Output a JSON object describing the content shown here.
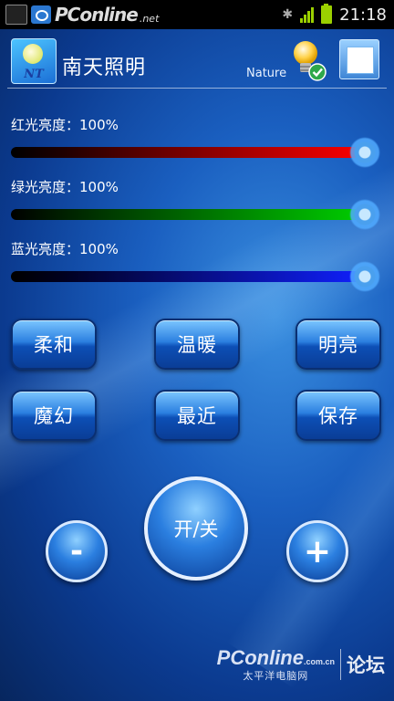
{
  "status_bar": {
    "brand": "PConline",
    "brand_net": ".net",
    "time": "21:18"
  },
  "header": {
    "app_title": "南天照明",
    "logo_text": "NT",
    "mode_label": "Nature"
  },
  "sliders": [
    {
      "label": "红光亮度：100%",
      "color": "#ff0000",
      "level": 1.0
    },
    {
      "label": "绿光亮度：100%",
      "color": "#00d000",
      "level": 1.0
    },
    {
      "label": "蓝光亮度：100%",
      "color": "#1020ff",
      "level": 1.0
    }
  ],
  "presets": {
    "soft": "柔和",
    "warm": "温暖",
    "bright": "明亮",
    "magic": "魔幻",
    "recent": "最近",
    "save": "保存"
  },
  "controls": {
    "minus": "-",
    "power": "开/关",
    "plus": "+"
  },
  "watermark": {
    "logo": "PConline",
    "domain": ".com.cn",
    "subtitle": "太平洋电脑网",
    "forum": "论坛"
  }
}
